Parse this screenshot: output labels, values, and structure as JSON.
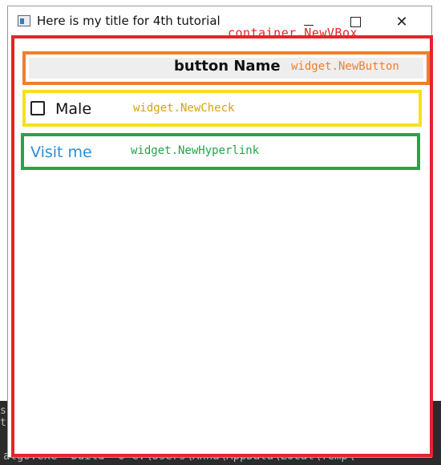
{
  "window": {
    "title": "Here is my title for 4th tutorial",
    "minimize_glyph": "—",
    "close_glyph": "✕"
  },
  "annotations": {
    "vbox": "container.NewVBox",
    "button": "widget.NewButton",
    "check": "widget.NewCheck",
    "hyperlink": "widget.NewHyperlink"
  },
  "content": {
    "button_label": "button Name",
    "check_label": "Male",
    "check_checked": false,
    "hyperlink_label": "Visit me"
  },
  "background_terminal": {
    "text": "algo.exe\" build -o C:\\Users\\Anna\\AppData\\Local\\Temp\\",
    "edge_text": "s\nt"
  },
  "colors": {
    "vbox": "#e8232a",
    "button": "#f07e2a",
    "check": "#f5e11a",
    "check_label": "#d8a20c",
    "hyperlink_box": "#22a64a",
    "hyperlink_text": "#2b8fd6"
  }
}
